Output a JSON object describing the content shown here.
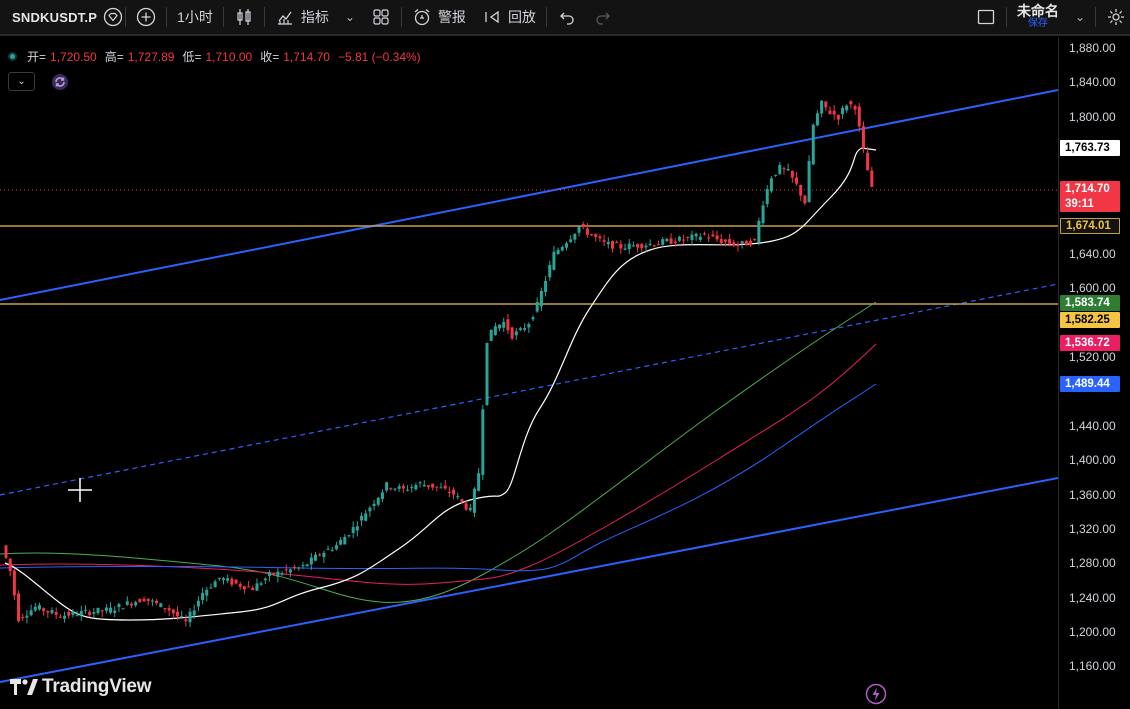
{
  "toolbar": {
    "symbol": "SNDKUSDT.P",
    "interval": "1小时",
    "indicators_label": "指标",
    "alert_label": "警报",
    "replay_label": "回放",
    "layout_name": "未命名",
    "save_label": "保存"
  },
  "legend": {
    "open_key": "开=",
    "open_val": "1,720.50",
    "high_key": "高=",
    "high_val": "1,727.89",
    "low_key": "低=",
    "low_val": "1,710.00",
    "close_key": "收=",
    "close_val": "1,714.70",
    "change": "−5.81 (−0.34%)"
  },
  "price_axis": {
    "ticks": [
      "1,880.00",
      "1,840.00",
      "1,800.00",
      "1,640.00",
      "1,600.00",
      "1,520.00",
      "1,440.00",
      "1,400.00",
      "1,360.00",
      "1,320.00",
      "1,280.00",
      "1,240.00",
      "1,200.00",
      "1,160.00"
    ],
    "tags": [
      {
        "label": "1,763.73",
        "bg": "#ffffff",
        "fg": "#000000"
      },
      {
        "label": "1,714.70",
        "bg": "#f23645",
        "fg": "#ffffff"
      },
      {
        "label": "39:11",
        "bg": "#f23645",
        "fg": "#ffffff"
      },
      {
        "label": "1,674.01",
        "bg": "#131313",
        "fg": "#f0c040"
      },
      {
        "label": "1,583.74",
        "bg": "#2e7d32",
        "fg": "#ffffff"
      },
      {
        "label": "1,582.25",
        "bg": "#f5c542",
        "fg": "#000000"
      },
      {
        "label": "1,536.72",
        "bg": "#e91e63",
        "fg": "#ffffff"
      },
      {
        "label": "1,489.44",
        "bg": "#2962ff",
        "fg": "#ffffff"
      }
    ]
  },
  "brand": {
    "logo_text": "TradingView"
  },
  "colors": {
    "up": "#26a69a",
    "down": "#f23645",
    "channel": "#2962ff",
    "hline": "#c8a045",
    "ma_white": "#ffffff",
    "ma_green": "#4caf50",
    "ma_pink": "#e91e63",
    "ma_blue": "#2962ff"
  },
  "chart_data": {
    "type": "candlestick",
    "symbol": "SNDKUSDT.P",
    "interval": "1小时",
    "ylim": [
      1140,
      1890
    ],
    "last_price": 1714.7,
    "ohlc_last": {
      "open": 1720.5,
      "high": 1727.89,
      "low": 1710.0,
      "close": 1714.7
    },
    "horizontal_levels": [
      1674.01,
      1582.25
    ],
    "moving_averages": [
      {
        "color": "white",
        "last": 1763.73
      },
      {
        "color": "green",
        "last": 1583.74
      },
      {
        "color": "pink",
        "last": 1536.72
      },
      {
        "color": "blue",
        "last": 1489.44
      }
    ],
    "price_path": [
      [
        0,
        1300
      ],
      [
        2,
        1270
      ],
      [
        4,
        1215
      ],
      [
        8,
        1228
      ],
      [
        14,
        1218
      ],
      [
        20,
        1222
      ],
      [
        26,
        1225
      ],
      [
        30,
        1232
      ],
      [
        34,
        1238
      ],
      [
        40,
        1225
      ],
      [
        44,
        1210
      ],
      [
        48,
        1245
      ],
      [
        52,
        1262
      ],
      [
        56,
        1255
      ],
      [
        60,
        1250
      ],
      [
        64,
        1265
      ],
      [
        68,
        1270
      ],
      [
        72,
        1275
      ],
      [
        76,
        1290
      ],
      [
        80,
        1300
      ],
      [
        84,
        1320
      ],
      [
        88,
        1345
      ],
      [
        92,
        1370
      ],
      [
        96,
        1365
      ],
      [
        100,
        1372
      ],
      [
        104,
        1368
      ],
      [
        108,
        1360
      ],
      [
        112,
        1340
      ],
      [
        114,
        1385
      ],
      [
        116,
        1540
      ],
      [
        118,
        1555
      ],
      [
        120,
        1560
      ],
      [
        122,
        1545
      ],
      [
        124,
        1550
      ],
      [
        126,
        1560
      ],
      [
        128,
        1580
      ],
      [
        130,
        1610
      ],
      [
        132,
        1640
      ],
      [
        134,
        1650
      ],
      [
        136,
        1660
      ],
      [
        138,
        1672
      ],
      [
        140,
        1665
      ],
      [
        144,
        1652
      ],
      [
        148,
        1648
      ],
      [
        152,
        1650
      ],
      [
        156,
        1652
      ],
      [
        160,
        1655
      ],
      [
        164,
        1658
      ],
      [
        168,
        1662
      ],
      [
        172,
        1655
      ],
      [
        176,
        1650
      ],
      [
        180,
        1655
      ],
      [
        182,
        1700
      ],
      [
        184,
        1730
      ],
      [
        186,
        1740
      ],
      [
        188,
        1735
      ],
      [
        190,
        1720
      ],
      [
        192,
        1700
      ],
      [
        194,
        1790
      ],
      [
        196,
        1815
      ],
      [
        198,
        1805
      ],
      [
        200,
        1800
      ],
      [
        202,
        1815
      ],
      [
        204,
        1812
      ],
      [
        206,
        1760
      ],
      [
        208,
        1714.7
      ]
    ]
  }
}
